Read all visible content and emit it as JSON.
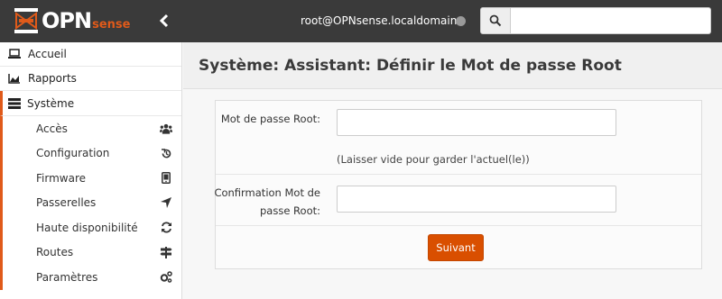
{
  "brand": {
    "logo_text": "OPN",
    "logo_sense": "sense",
    "accent": "#e05a1a"
  },
  "topbar": {
    "user": "root@OPNsense.localdomain",
    "search_placeholder": "",
    "search_value": ""
  },
  "sidebar": {
    "top_items": [
      {
        "label": "Accueil",
        "icon": "laptop-icon"
      },
      {
        "label": "Rapports",
        "icon": "area-chart-icon"
      }
    ],
    "system": {
      "label": "Système",
      "icon": "server-icon"
    },
    "sub_items": [
      {
        "label": "Accès",
        "icon": "users-icon"
      },
      {
        "label": "Configuration",
        "icon": "history-icon"
      },
      {
        "label": "Firmware",
        "icon": "tablet-icon"
      },
      {
        "label": "Passerelles",
        "icon": "location-arrow-icon"
      },
      {
        "label": "Haute disponibilité",
        "icon": "refresh-icon"
      },
      {
        "label": "Routes",
        "icon": "map-signs-icon"
      },
      {
        "label": "Paramètres",
        "icon": "cogs-icon"
      }
    ]
  },
  "main": {
    "title": "Système: Assistant: Définir le Mot de passe Root",
    "form": {
      "root_password_label": "Mot de passe Root:",
      "root_password_value": "",
      "root_password_hint": "(Laisser vide pour garder l'actuel(le))",
      "confirm_label": "Confirmation Mot de passe Root:",
      "confirm_value": "",
      "next_label": "Suivant"
    }
  }
}
